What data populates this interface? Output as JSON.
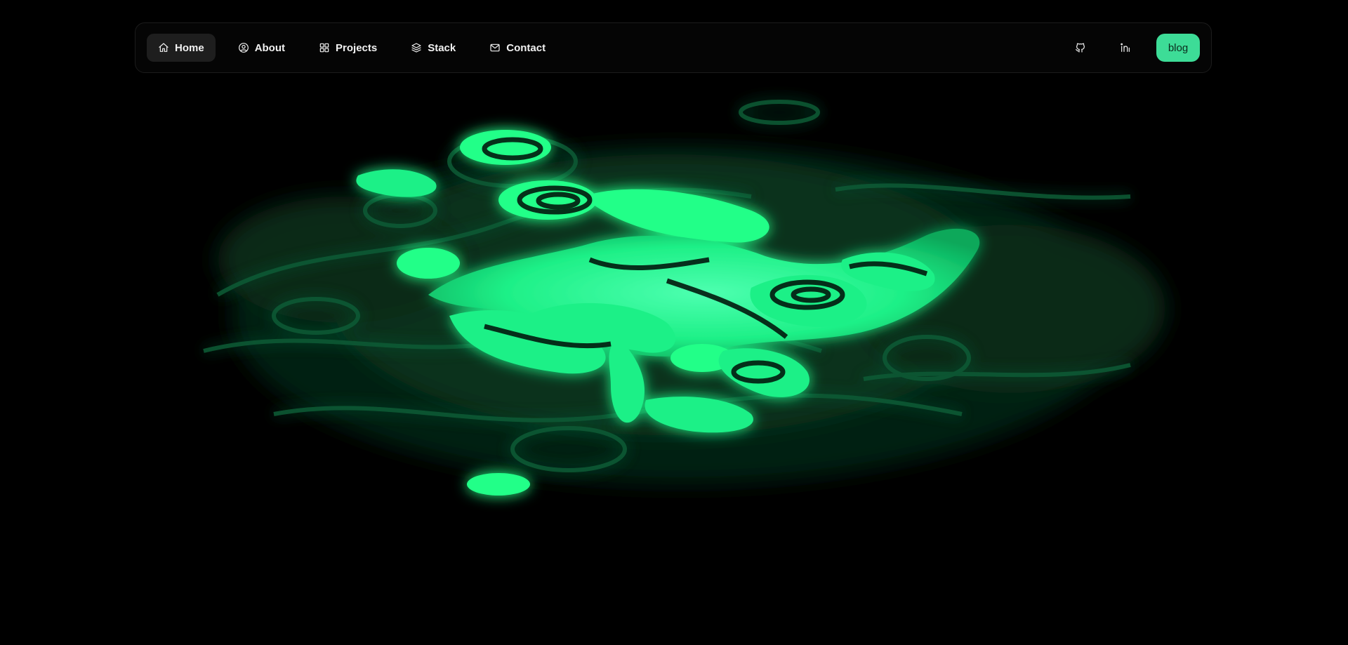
{
  "nav": {
    "links": [
      {
        "label": "Home",
        "icon": "home-icon",
        "active": true
      },
      {
        "label": "About",
        "icon": "user-circle-icon",
        "active": false
      },
      {
        "label": "Projects",
        "icon": "grid-icon",
        "active": false
      },
      {
        "label": "Stack",
        "icon": "layers-icon",
        "active": false
      },
      {
        "label": "Contact",
        "icon": "mail-icon",
        "active": false
      }
    ],
    "social": [
      {
        "icon": "github-icon"
      },
      {
        "icon": "linkedin-icon"
      }
    ],
    "blog_label": "blog"
  },
  "colors": {
    "background": "#000000",
    "accent": "#3ddc97",
    "fluid_bright": "#22ff88",
    "fluid_dark": "#0b4d2c"
  }
}
